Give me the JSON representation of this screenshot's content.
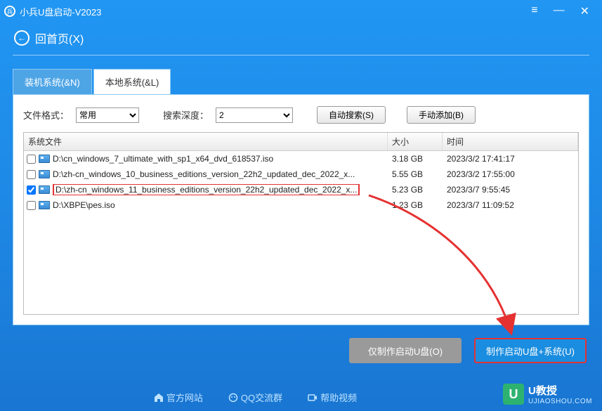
{
  "window": {
    "title": "小兵U盘启动-V2023"
  },
  "back": {
    "label": "回首页(X)"
  },
  "tabs": {
    "install": "装机系统(&N)",
    "local": "本地系统(&L)"
  },
  "controls": {
    "file_format_label": "文件格式：",
    "file_format_value": "常用",
    "search_depth_label": "搜索深度：",
    "search_depth_value": "2",
    "auto_search": "自动搜索(S)",
    "manual_add": "手动添加(B)"
  },
  "grid": {
    "headers": {
      "file": "系统文件",
      "size": "大小",
      "time": "时间"
    },
    "rows": [
      {
        "checked": false,
        "name": "D:\\cn_windows_7_ultimate_with_sp1_x64_dvd_618537.iso",
        "size": "3.18 GB",
        "time": "2023/3/2 17:41:17",
        "hl": false
      },
      {
        "checked": false,
        "name": "D:\\zh-cn_windows_10_business_editions_version_22h2_updated_dec_2022_x...",
        "size": "5.55 GB",
        "time": "2023/3/2 17:55:00",
        "hl": false
      },
      {
        "checked": true,
        "name": "D:\\zh-cn_windows_11_business_editions_version_22h2_updated_dec_2022_x...",
        "size": "5.23 GB",
        "time": "2023/3/7 9:55:45",
        "hl": true
      },
      {
        "checked": false,
        "name": "D:\\XBPE\\pes.iso",
        "size": "1.23 GB",
        "time": "2023/3/7 11:09:52",
        "hl": false
      }
    ]
  },
  "footer": {
    "make_only": "仅制作启动U盘(O)",
    "make_sys": "制作启动U盘+系统(U)"
  },
  "links": {
    "site": "官方网站",
    "qq": "QQ交流群",
    "video": "帮助视频"
  },
  "watermark": {
    "brand": "U教授",
    "url": "UJIAOSHOU.COM"
  }
}
